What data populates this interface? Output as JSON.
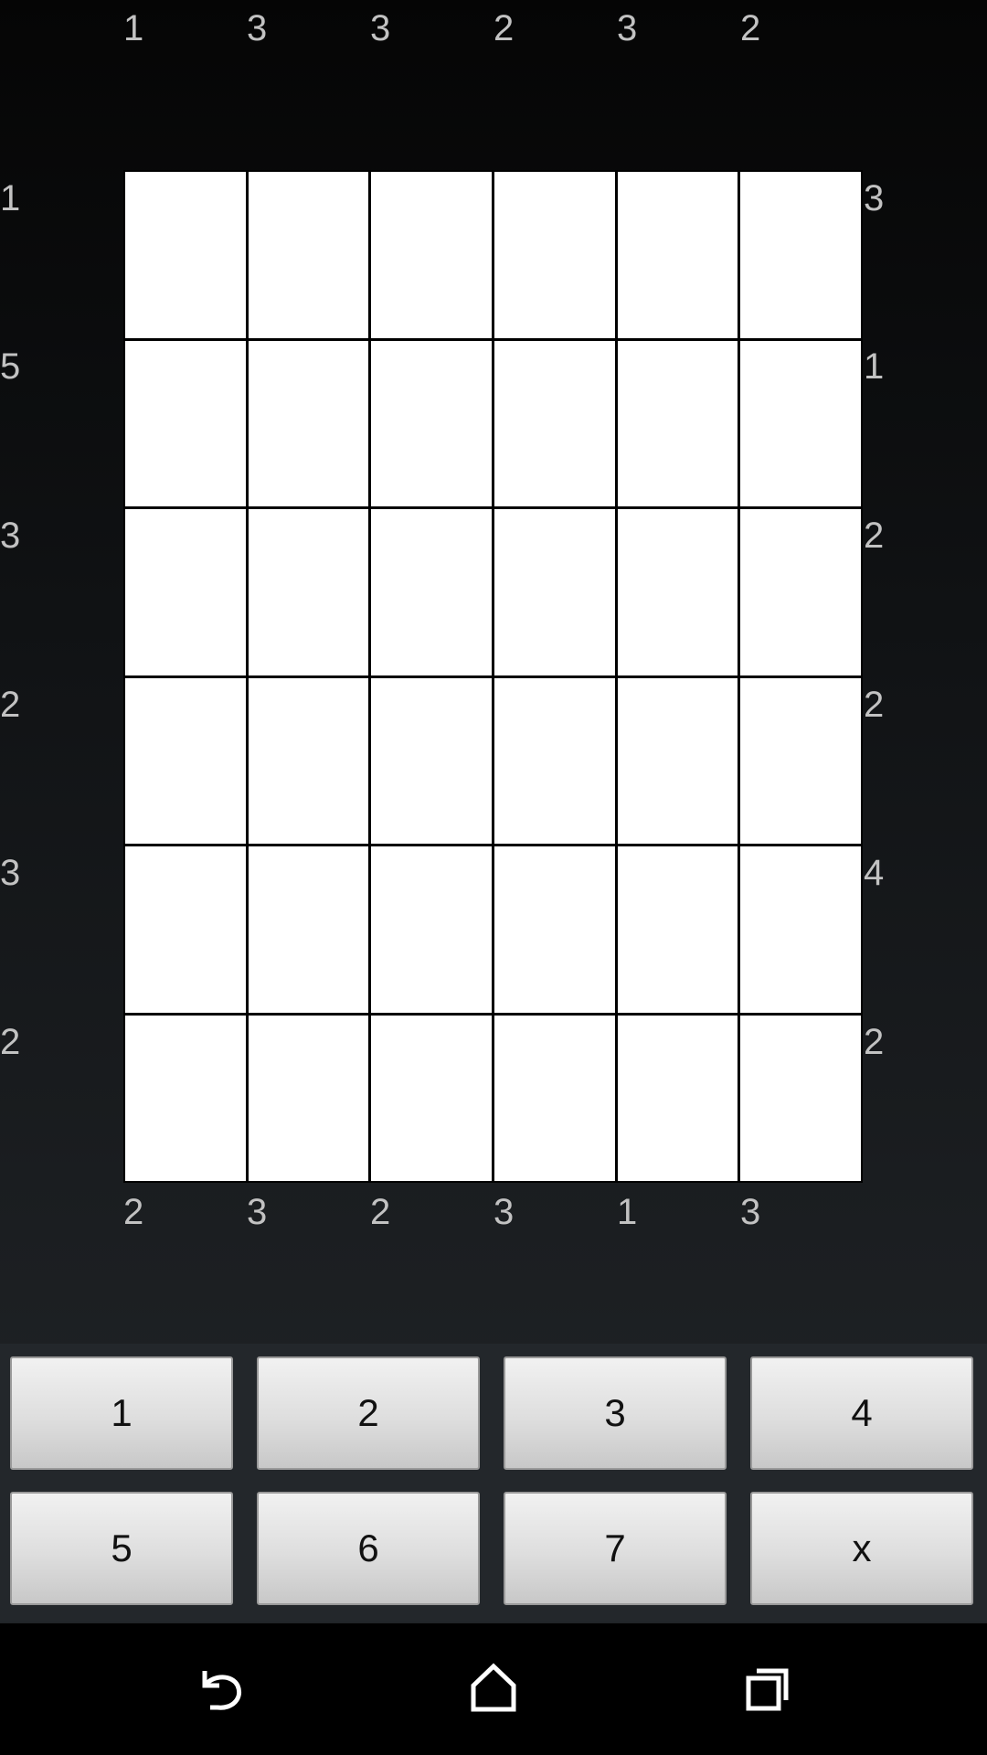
{
  "puzzle": {
    "top_clues": [
      "1",
      "3",
      "3",
      "2",
      "3",
      "2"
    ],
    "bottom_clues": [
      "2",
      "3",
      "2",
      "3",
      "1",
      "3"
    ],
    "left_clues": [
      "1",
      "5",
      "3",
      "2",
      "3",
      "2"
    ],
    "right_clues": [
      "3",
      "1",
      "2",
      "2",
      "4",
      "2"
    ],
    "grid": [
      [
        "",
        "",
        "",
        "",
        "",
        ""
      ],
      [
        "",
        "",
        "",
        "",
        "",
        ""
      ],
      [
        "",
        "",
        "",
        "",
        "",
        ""
      ],
      [
        "",
        "",
        "",
        "",
        "",
        ""
      ],
      [
        "",
        "",
        "",
        "",
        "",
        ""
      ],
      [
        "",
        "",
        "",
        "",
        "",
        ""
      ]
    ]
  },
  "keypad": {
    "keys": [
      "1",
      "2",
      "3",
      "4",
      "5",
      "6",
      "7",
      "x"
    ]
  },
  "navbar": {
    "icons": [
      "back-icon",
      "home-icon",
      "recents-icon"
    ],
    "icon_color": "#ffffff"
  }
}
